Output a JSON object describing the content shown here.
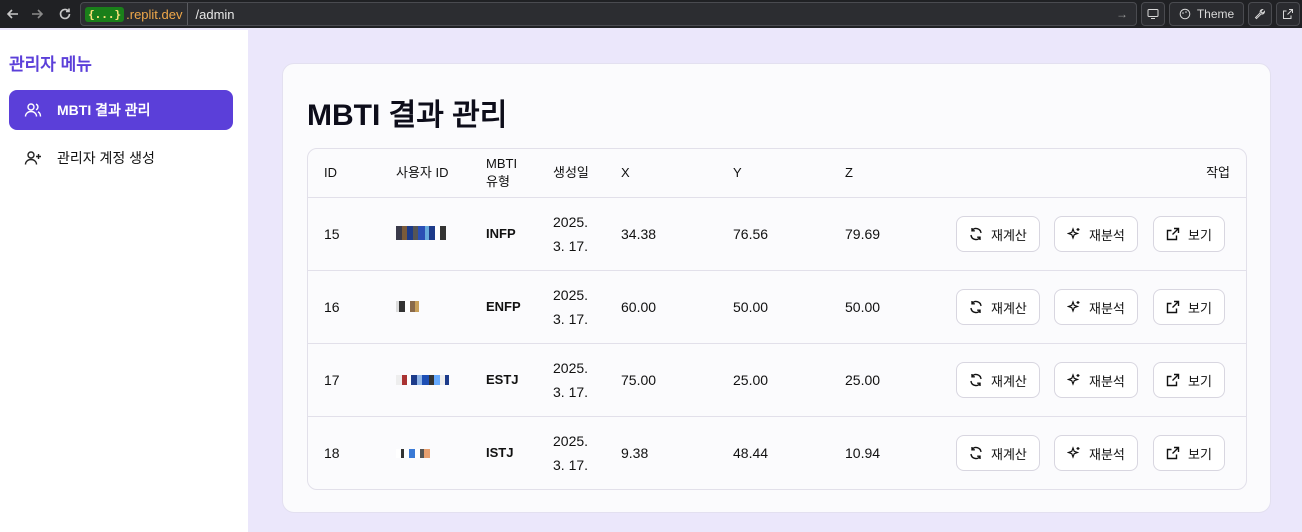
{
  "browser": {
    "badge": "{...}",
    "domain": ".replit.dev",
    "path": "/admin",
    "theme_label": "Theme"
  },
  "sidebar": {
    "title": "관리자 메뉴",
    "items": [
      {
        "label": "MBTI 결과 관리",
        "icon": "users-icon",
        "active": true
      },
      {
        "label": "관리자 계정 생성",
        "icon": "user-plus-icon",
        "active": false
      }
    ]
  },
  "main": {
    "title": "MBTI 결과 관리",
    "columns": {
      "id": "ID",
      "user_id": "사용자 ID",
      "mbti_line1": "MBTI",
      "mbti_line2": "유형",
      "created": "생성일",
      "x": "X",
      "y": "Y",
      "z": "Z",
      "actions": "작업"
    },
    "rows": [
      {
        "id": "15",
        "mbti": "INFP",
        "date_line1": "2025.",
        "date_line2": "3. 17.",
        "x": "34.38",
        "y": "76.56",
        "z": "79.69"
      },
      {
        "id": "16",
        "mbti": "ENFP",
        "date_line1": "2025.",
        "date_line2": "3. 17.",
        "x": "60.00",
        "y": "50.00",
        "z": "50.00"
      },
      {
        "id": "17",
        "mbti": "ESTJ",
        "date_line1": "2025.",
        "date_line2": "3. 17.",
        "x": "75.00",
        "y": "25.00",
        "z": "25.00"
      },
      {
        "id": "18",
        "mbti": "ISTJ",
        "date_line1": "2025.",
        "date_line2": "3. 17.",
        "x": "9.38",
        "y": "48.44",
        "z": "10.94"
      }
    ],
    "actions": {
      "recalc": "재계산",
      "reanalyze": "재분석",
      "view": "보기"
    }
  },
  "colors": {
    "accent": "#5b3fd9",
    "page_bg": "#ebe7fb"
  }
}
